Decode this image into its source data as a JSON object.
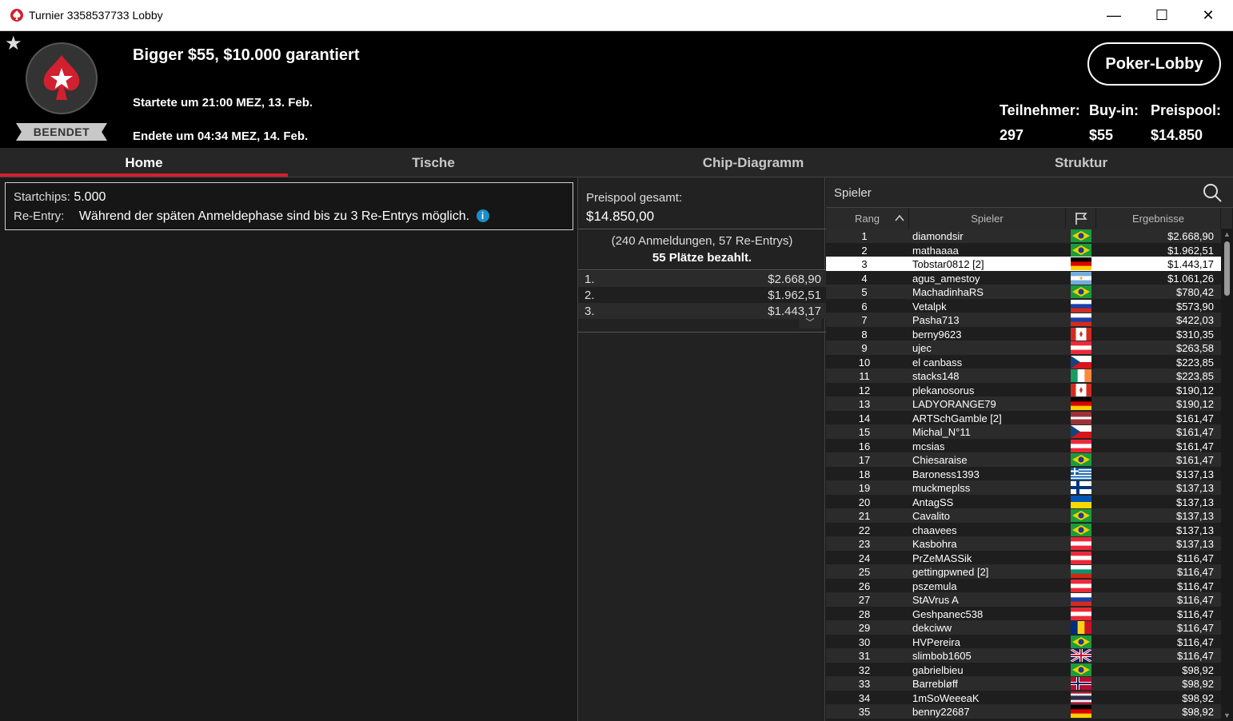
{
  "window": {
    "title": "Turnier 3358537733 Lobby",
    "minimize": "—",
    "maximize": "☐",
    "close": "✕"
  },
  "header": {
    "favorite_icon": "★",
    "status": "BEENDET",
    "tournament_name": "Bigger $55, $10.000 garantiert",
    "started": "Startete um 21:00 MEZ, 13. Feb.",
    "ended": "Endete um 04:34 MEZ, 14. Feb.",
    "lobby_button": "Poker-Lobby",
    "stats": [
      {
        "label": "Teilnehmer:",
        "value": "297"
      },
      {
        "label": "Buy-in:",
        "value": "$55"
      },
      {
        "label": "Preispool:",
        "value": "$14.850"
      }
    ]
  },
  "tabs": [
    "Home",
    "Tische",
    "Chip-Diagramm",
    "Struktur"
  ],
  "home": {
    "startchips_label": "Startchips:",
    "startchips_value": "5.000",
    "reentry_label": "Re-Entry:",
    "reentry_value": "Während der späten Anmeldephase sind bis zu 3 Re-Entrys möglich.",
    "info_icon": "i"
  },
  "prizepool": {
    "label": "Preispool gesamt:",
    "value": "$14.850,00",
    "entries": "(240 Anmeldungen, 57 Re-Entrys)",
    "paid": "55 Plätze bezahlt.",
    "payouts": [
      {
        "pos": "1.",
        "amount": "$2.668,90"
      },
      {
        "pos": "2.",
        "amount": "$1.962,51"
      },
      {
        "pos": "3.",
        "amount": "$1.443,17"
      }
    ],
    "expand_icon": "﹀"
  },
  "players": {
    "search_placeholder": "Spieler",
    "columns": {
      "rank": "Rang",
      "player": "Spieler",
      "result": "Ergebnisse",
      "sort_arrow": "^"
    },
    "selected_row": 3,
    "rows": [
      {
        "rank": "1",
        "name": "diamondsir",
        "flag": "BR",
        "result": "$2.668,90"
      },
      {
        "rank": "2",
        "name": "mathaaaa",
        "flag": "BR",
        "result": "$1.962,51"
      },
      {
        "rank": "3",
        "name": "Tobstar0812 [2]",
        "flag": "DE",
        "result": "$1.443,17"
      },
      {
        "rank": "4",
        "name": "agus_amestoy",
        "flag": "AR",
        "result": "$1.061,26"
      },
      {
        "rank": "5",
        "name": "MachadinhaRS",
        "flag": "BR",
        "result": "$780,42"
      },
      {
        "rank": "6",
        "name": "Vetalpk",
        "flag": "RU",
        "result": "$573,90"
      },
      {
        "rank": "7",
        "name": "Pasha713",
        "flag": "RU",
        "result": "$422,03"
      },
      {
        "rank": "8",
        "name": "berny9623",
        "flag": "CA",
        "result": "$310,35"
      },
      {
        "rank": "9",
        "name": "ujec",
        "flag": "AT",
        "result": "$263,58"
      },
      {
        "rank": "10",
        "name": "el canbass",
        "flag": "CZ",
        "result": "$223,85"
      },
      {
        "rank": "11",
        "name": "stacks148",
        "flag": "IE",
        "result": "$223,85"
      },
      {
        "rank": "12",
        "name": "plekanosorus",
        "flag": "CA",
        "result": "$190,12"
      },
      {
        "rank": "13",
        "name": "LADYORANGE79",
        "flag": "DE",
        "result": "$190,12"
      },
      {
        "rank": "14",
        "name": "ARTSchGamble [2]",
        "flag": "LV",
        "result": "$161,47"
      },
      {
        "rank": "15",
        "name": "Michal_N°11",
        "flag": "CZ",
        "result": "$161,47"
      },
      {
        "rank": "16",
        "name": "mcsias",
        "flag": "AT",
        "result": "$161,47"
      },
      {
        "rank": "17",
        "name": "Chiesaraise",
        "flag": "BR",
        "result": "$161,47"
      },
      {
        "rank": "18",
        "name": "Baroness1393",
        "flag": "GR",
        "result": "$137,13"
      },
      {
        "rank": "19",
        "name": "muckmeplss",
        "flag": "FI",
        "result": "$137,13"
      },
      {
        "rank": "20",
        "name": "AntagSS",
        "flag": "UA",
        "result": "$137,13"
      },
      {
        "rank": "21",
        "name": "Cavalito",
        "flag": "BR",
        "result": "$137,13"
      },
      {
        "rank": "22",
        "name": "chaavees",
        "flag": "BR",
        "result": "$137,13"
      },
      {
        "rank": "23",
        "name": "Kasbohra",
        "flag": "AT",
        "result": "$137,13"
      },
      {
        "rank": "24",
        "name": "PrZeMASSik",
        "flag": "AT",
        "result": "$116,47"
      },
      {
        "rank": "25",
        "name": "gettingpwned [2]",
        "flag": "BG",
        "result": "$116,47"
      },
      {
        "rank": "26",
        "name": "pszemula",
        "flag": "AT",
        "result": "$116,47"
      },
      {
        "rank": "27",
        "name": "StAVrus A",
        "flag": "RU",
        "result": "$116,47"
      },
      {
        "rank": "28",
        "name": "Geshpanec538",
        "flag": "AT",
        "result": "$116,47"
      },
      {
        "rank": "29",
        "name": "dekciww",
        "flag": "RO",
        "result": "$116,47"
      },
      {
        "rank": "30",
        "name": "HVPereira",
        "flag": "BR",
        "result": "$116,47"
      },
      {
        "rank": "31",
        "name": "slimbob1605",
        "flag": "GB",
        "result": "$116,47"
      },
      {
        "rank": "32",
        "name": "gabrielbieu",
        "flag": "BR",
        "result": "$98,92"
      },
      {
        "rank": "33",
        "name": "Barrebløff",
        "flag": "NO",
        "result": "$98,92"
      },
      {
        "rank": "34",
        "name": "1mSoWeeeaK",
        "flag": "TH",
        "result": "$98,92"
      },
      {
        "rank": "35",
        "name": "benny22687",
        "flag": "DE",
        "result": "$98,92"
      }
    ]
  },
  "colors": {
    "accent": "#d1202f",
    "highlight_row": "#ffffff",
    "info_blue": "#1a8ec8"
  }
}
